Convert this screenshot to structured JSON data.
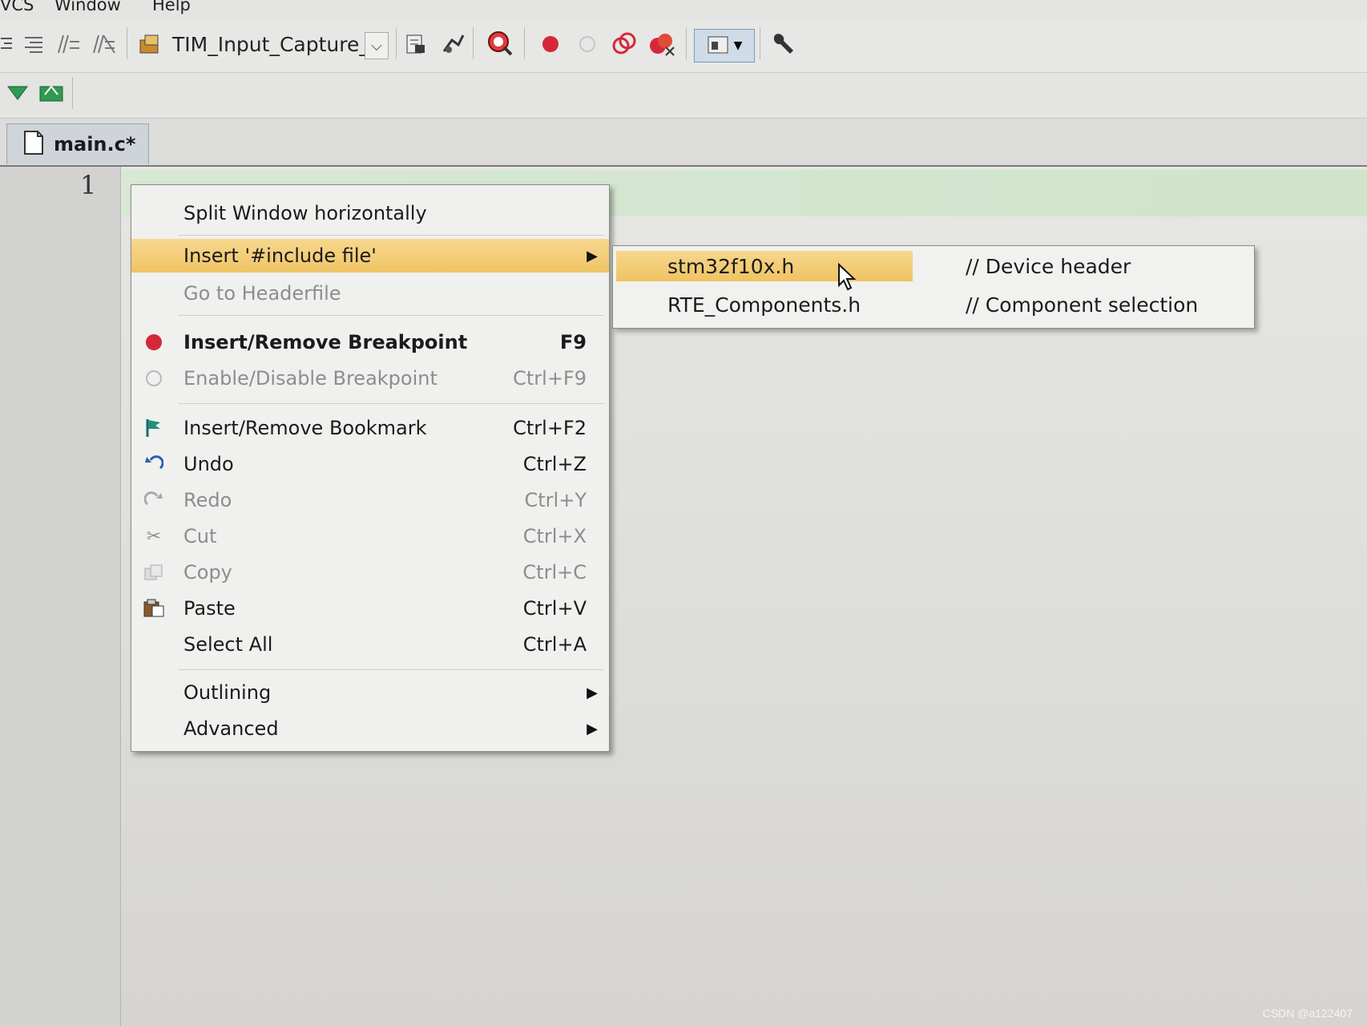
{
  "menubar": {
    "items": [
      "VCS",
      "Window",
      "Help"
    ]
  },
  "toolbar": {
    "project": "TIM_Input_Capture_"
  },
  "tabs": [
    {
      "label": "main.c*"
    }
  ],
  "editor": {
    "line_number": "1"
  },
  "context_menu": {
    "items": [
      {
        "label": "Split Window horizontally",
        "shortcut": "",
        "state": "normal"
      },
      {
        "label": "Insert '#include file'",
        "shortcut": "",
        "state": "highlighted",
        "submenu": true
      },
      {
        "label": "Go to Headerfile",
        "shortcut": "",
        "state": "disabled"
      },
      {
        "label": "Insert/Remove Breakpoint",
        "shortcut": "F9",
        "state": "bold",
        "icon": "breakpoint-icon"
      },
      {
        "label": "Enable/Disable Breakpoint",
        "shortcut": "Ctrl+F9",
        "state": "disabled",
        "icon": "breakpoint-outline-icon"
      },
      {
        "label": "Insert/Remove Bookmark",
        "shortcut": "Ctrl+F2",
        "state": "normal",
        "icon": "bookmark-flag-icon"
      },
      {
        "label": "Undo",
        "shortcut": "Ctrl+Z",
        "state": "normal",
        "icon": "undo-icon"
      },
      {
        "label": "Redo",
        "shortcut": "Ctrl+Y",
        "state": "disabled",
        "icon": "redo-icon"
      },
      {
        "label": "Cut",
        "shortcut": "Ctrl+X",
        "state": "disabled",
        "icon": "scissors-icon"
      },
      {
        "label": "Copy",
        "shortcut": "Ctrl+C",
        "state": "disabled",
        "icon": "copy-icon"
      },
      {
        "label": "Paste",
        "shortcut": "Ctrl+V",
        "state": "normal",
        "icon": "clipboard-icon"
      },
      {
        "label": "Select All",
        "shortcut": "Ctrl+A",
        "state": "normal"
      },
      {
        "label": "Outlining",
        "shortcut": "",
        "state": "normal",
        "submenu": true
      },
      {
        "label": "Advanced",
        "shortcut": "",
        "state": "normal",
        "submenu": true
      }
    ]
  },
  "include_submenu": {
    "items": [
      {
        "file": "stm32f10x.h",
        "comment": "// Device header",
        "highlighted": true
      },
      {
        "file": "RTE_Components.h",
        "comment": "// Component selection",
        "highlighted": false
      }
    ]
  },
  "colors": {
    "highlight": "#f0c466",
    "breakpoint": "#d4283a",
    "line_highlight": "#cfe4cb"
  },
  "watermark": "CSDN @a122407"
}
